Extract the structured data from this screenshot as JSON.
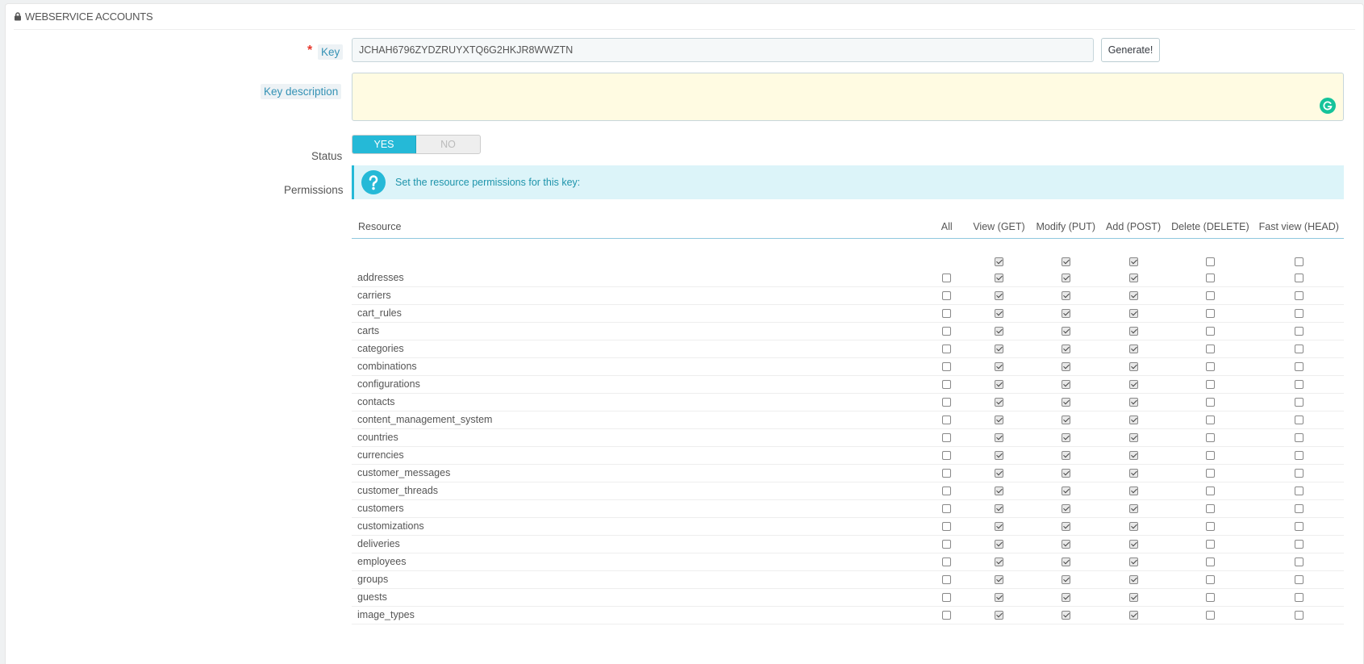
{
  "panel": {
    "title": "WEBSERVICE ACCOUNTS"
  },
  "form": {
    "key_label": "Key",
    "required_mark": "*",
    "key_value": "JCHAH6796ZYDZRUYXTQ6G2HKJR8WWZTN",
    "generate_label": "Generate!",
    "description_label": "Key description",
    "description_value": "",
    "status_label": "Status",
    "status_yes": "YES",
    "status_no": "NO",
    "status_selected": "YES",
    "permissions_label": "Permissions",
    "permissions_hint": "Set the resource permissions for this key:"
  },
  "table": {
    "headers": {
      "resource": "Resource",
      "all": "All",
      "get": "View (GET)",
      "put": "Modify (PUT)",
      "post": "Add (POST)",
      "delete": "Delete (DELETE)",
      "head": "Fast view (HEAD)"
    },
    "select_all": {
      "get": true,
      "put": true,
      "post": true,
      "delete": false,
      "head": false
    },
    "rows": [
      {
        "name": "addresses",
        "all": false,
        "get": true,
        "put": true,
        "post": true,
        "delete": false,
        "head": false
      },
      {
        "name": "carriers",
        "all": false,
        "get": true,
        "put": true,
        "post": true,
        "delete": false,
        "head": false
      },
      {
        "name": "cart_rules",
        "all": false,
        "get": true,
        "put": true,
        "post": true,
        "delete": false,
        "head": false
      },
      {
        "name": "carts",
        "all": false,
        "get": true,
        "put": true,
        "post": true,
        "delete": false,
        "head": false
      },
      {
        "name": "categories",
        "all": false,
        "get": true,
        "put": true,
        "post": true,
        "delete": false,
        "head": false
      },
      {
        "name": "combinations",
        "all": false,
        "get": true,
        "put": true,
        "post": true,
        "delete": false,
        "head": false
      },
      {
        "name": "configurations",
        "all": false,
        "get": true,
        "put": true,
        "post": true,
        "delete": false,
        "head": false
      },
      {
        "name": "contacts",
        "all": false,
        "get": true,
        "put": true,
        "post": true,
        "delete": false,
        "head": false
      },
      {
        "name": "content_management_system",
        "all": false,
        "get": true,
        "put": true,
        "post": true,
        "delete": false,
        "head": false
      },
      {
        "name": "countries",
        "all": false,
        "get": true,
        "put": true,
        "post": true,
        "delete": false,
        "head": false
      },
      {
        "name": "currencies",
        "all": false,
        "get": true,
        "put": true,
        "post": true,
        "delete": false,
        "head": false
      },
      {
        "name": "customer_messages",
        "all": false,
        "get": true,
        "put": true,
        "post": true,
        "delete": false,
        "head": false
      },
      {
        "name": "customer_threads",
        "all": false,
        "get": true,
        "put": true,
        "post": true,
        "delete": false,
        "head": false
      },
      {
        "name": "customers",
        "all": false,
        "get": true,
        "put": true,
        "post": true,
        "delete": false,
        "head": false
      },
      {
        "name": "customizations",
        "all": false,
        "get": true,
        "put": true,
        "post": true,
        "delete": false,
        "head": false
      },
      {
        "name": "deliveries",
        "all": false,
        "get": true,
        "put": true,
        "post": true,
        "delete": false,
        "head": false
      },
      {
        "name": "employees",
        "all": false,
        "get": true,
        "put": true,
        "post": true,
        "delete": false,
        "head": false
      },
      {
        "name": "groups",
        "all": false,
        "get": true,
        "put": true,
        "post": true,
        "delete": false,
        "head": false
      },
      {
        "name": "guests",
        "all": false,
        "get": true,
        "put": true,
        "post": true,
        "delete": false,
        "head": false
      },
      {
        "name": "image_types",
        "all": false,
        "get": true,
        "put": true,
        "post": true,
        "delete": false,
        "head": false
      }
    ]
  },
  "colors": {
    "accent": "#25b9d7",
    "alert_bg": "#dcf4f9",
    "textarea_bg": "#fffbe2",
    "required": "#e7372b"
  }
}
